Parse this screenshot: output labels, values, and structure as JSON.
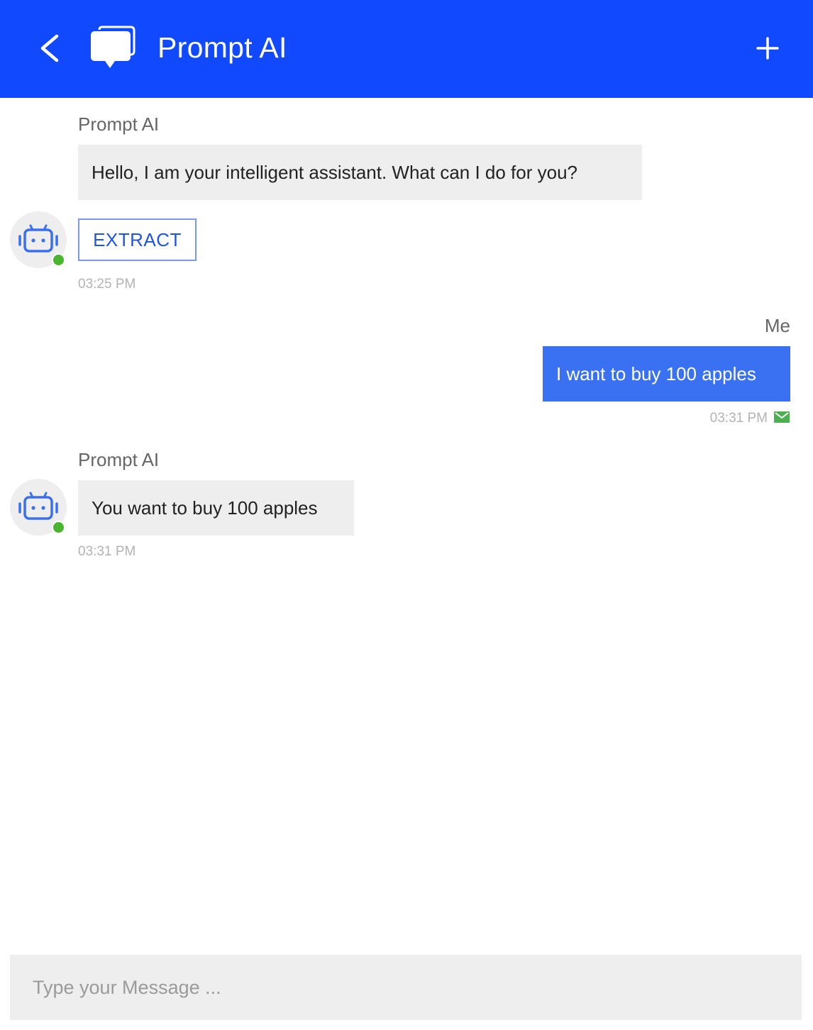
{
  "header": {
    "title": "Prompt AI",
    "back_icon": "chevron-left-icon",
    "logo_icon": "chat-bubbles-icon",
    "add_icon": "plus-icon",
    "background_color": "#1149ff"
  },
  "messages": [
    {
      "from": "bot",
      "sender": "Prompt AI",
      "text": "Hello, I am your intelligent assistant. What can I do for you?",
      "action_button": "EXTRACT",
      "time": "03:25 PM",
      "avatar_icon": "robot-icon",
      "online": true
    },
    {
      "from": "me",
      "sender": "Me",
      "text": "I want to buy 100 apples",
      "time": "03:31 PM",
      "status_icon": "mail-sent-icon"
    },
    {
      "from": "bot",
      "sender": "Prompt AI",
      "text": "You want to buy 100 apples",
      "time": "03:31 PM",
      "avatar_icon": "robot-icon",
      "online": true
    }
  ],
  "composer": {
    "placeholder": "Type your Message ...",
    "value": ""
  },
  "colors": {
    "accent": "#1149ff",
    "my_bubble": "#3a71f2",
    "bot_bubble": "#eeeeee",
    "online": "#49b52f",
    "sent_status": "#4caf50"
  }
}
